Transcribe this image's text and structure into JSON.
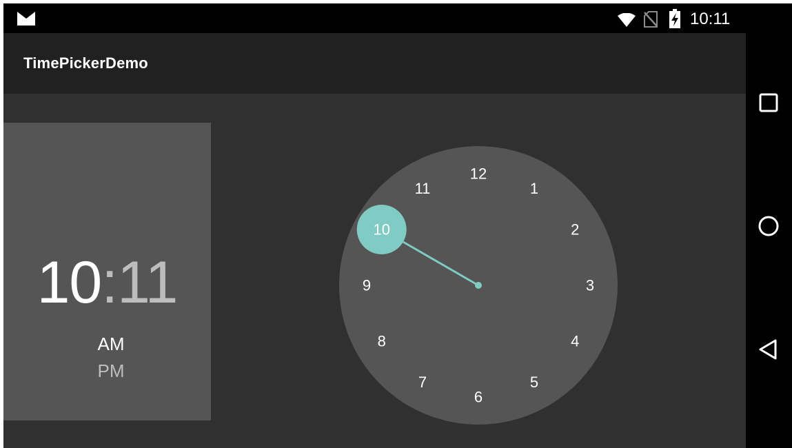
{
  "status_bar": {
    "time": "10:11",
    "icons": [
      "gmail-icon",
      "wifi-icon",
      "no-sim-icon",
      "battery-charging-icon"
    ]
  },
  "app_bar": {
    "title": "TimePickerDemo"
  },
  "time_picker": {
    "hour": "10",
    "separator": ":",
    "minute": "11",
    "am_label": "AM",
    "pm_label": "PM",
    "selected_period": "AM",
    "selected_hour": 10,
    "clock_numbers": [
      "12",
      "1",
      "2",
      "3",
      "4",
      "5",
      "6",
      "7",
      "8",
      "9",
      "10",
      "11"
    ]
  },
  "nav_bar": {
    "icons": [
      "recents-icon",
      "home-icon",
      "back-icon"
    ]
  },
  "colors": {
    "accent": "#80CBC4",
    "background": "#303030",
    "header_panel": "#555555",
    "clock_face": "#555555",
    "app_bar": "#212121"
  }
}
